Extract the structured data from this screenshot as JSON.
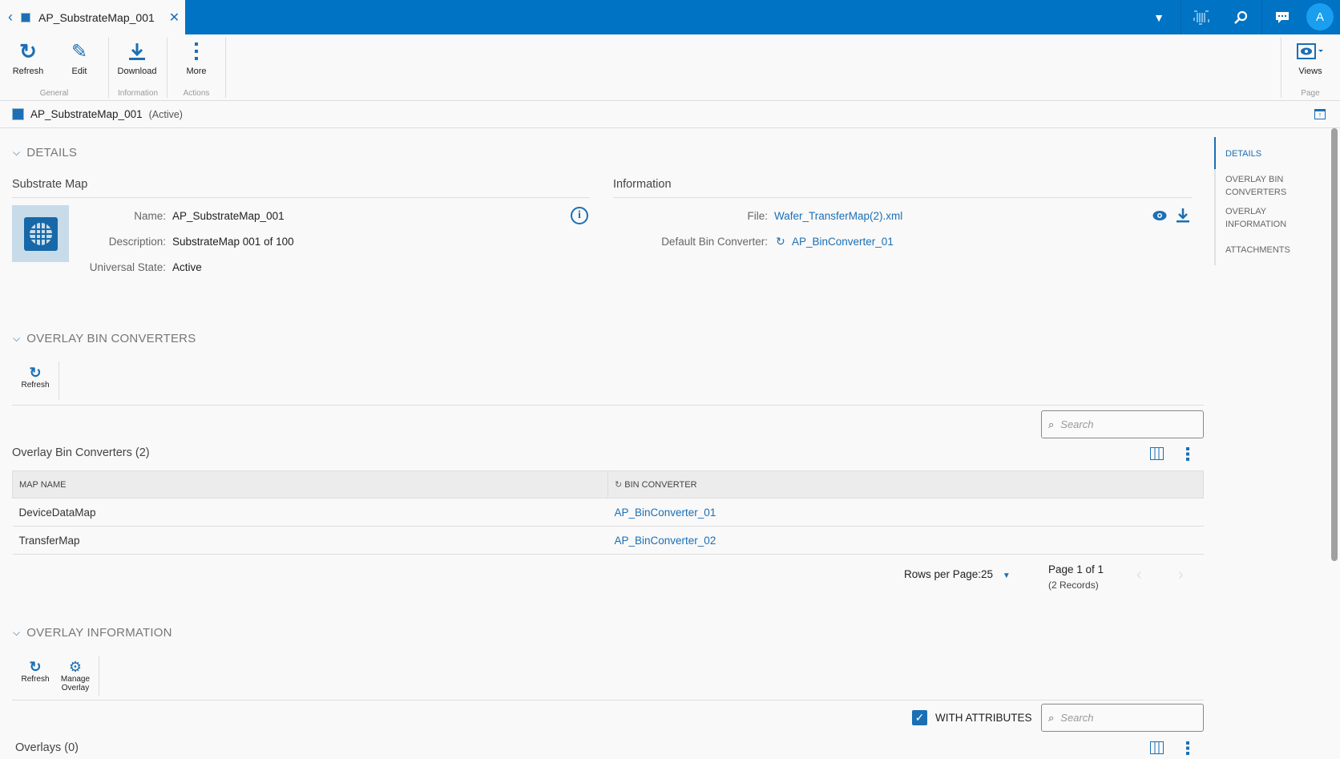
{
  "tab": {
    "title": "AP_SubstrateMap_001"
  },
  "topbar": {
    "avatar": "A"
  },
  "ribbon": {
    "buttons": {
      "refresh": "Refresh",
      "edit": "Edit",
      "download": "Download",
      "more": "More",
      "views": "Views"
    },
    "groups": {
      "general": "General",
      "information": "Information",
      "actions": "Actions",
      "page": "Page"
    }
  },
  "object": {
    "name": "AP_SubstrateMap_001",
    "state": "(Active)"
  },
  "details": {
    "header": "DETAILS",
    "substrate_title": "Substrate Map",
    "info_title": "Information",
    "fields": {
      "name_label": "Name:",
      "name": "AP_SubstrateMap_001",
      "desc_label": "Description:",
      "desc": "SubstrateMap 001 of 100",
      "state_label": "Universal State:",
      "state": "Active"
    },
    "info": {
      "file_label": "File:",
      "file": "Wafer_TransferMap(2).xml",
      "bin_label": "Default Bin Converter:",
      "bin": "AP_BinConverter_01"
    }
  },
  "nav": {
    "items": [
      "DETAILS",
      "OVERLAY BIN CONVERTERS",
      "OVERLAY INFORMATION",
      "ATTACHMENTS"
    ]
  },
  "obc": {
    "header": "OVERLAY BIN CONVERTERS",
    "refresh": "Refresh",
    "search_placeholder": "Search",
    "title": "Overlay Bin Converters (2)",
    "columns": [
      "MAP NAME",
      "BIN CONVERTER"
    ],
    "rows": [
      [
        "DeviceDataMap",
        "AP_BinConverter_01"
      ],
      [
        "TransferMap",
        "AP_BinConverter_02"
      ]
    ],
    "rows_per_page": "Rows per Page:25",
    "page": "Page 1 of 1",
    "records": "(2 Records)"
  },
  "oi": {
    "header": "OVERLAY INFORMATION",
    "refresh": "Refresh",
    "manage": "Manage Overlay",
    "with_attributes": "WITH ATTRIBUTES",
    "with_attributes_checked": true,
    "search_placeholder": "Search",
    "title": "Overlays (0)"
  },
  "colors": {
    "brand": "#0073c4",
    "link": "#1b6fb5"
  }
}
